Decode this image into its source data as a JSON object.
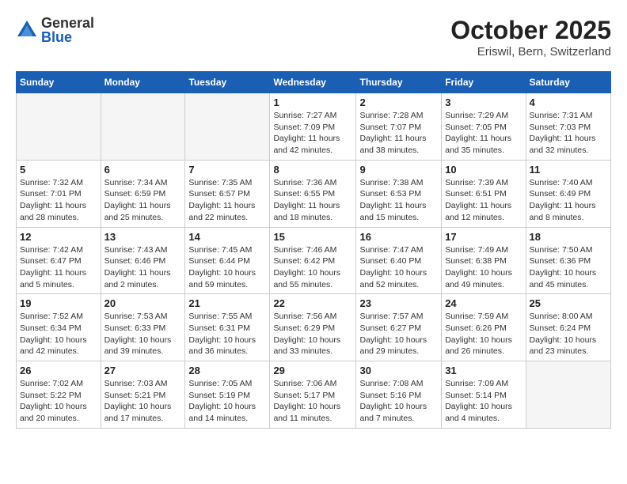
{
  "header": {
    "logo_general": "General",
    "logo_blue": "Blue",
    "month_title": "October 2025",
    "location": "Eriswil, Bern, Switzerland"
  },
  "weekdays": [
    "Sunday",
    "Monday",
    "Tuesday",
    "Wednesday",
    "Thursday",
    "Friday",
    "Saturday"
  ],
  "weeks": [
    [
      {
        "day": "",
        "info": ""
      },
      {
        "day": "",
        "info": ""
      },
      {
        "day": "",
        "info": ""
      },
      {
        "day": "1",
        "info": "Sunrise: 7:27 AM\nSunset: 7:09 PM\nDaylight: 11 hours and 42 minutes."
      },
      {
        "day": "2",
        "info": "Sunrise: 7:28 AM\nSunset: 7:07 PM\nDaylight: 11 hours and 38 minutes."
      },
      {
        "day": "3",
        "info": "Sunrise: 7:29 AM\nSunset: 7:05 PM\nDaylight: 11 hours and 35 minutes."
      },
      {
        "day": "4",
        "info": "Sunrise: 7:31 AM\nSunset: 7:03 PM\nDaylight: 11 hours and 32 minutes."
      }
    ],
    [
      {
        "day": "5",
        "info": "Sunrise: 7:32 AM\nSunset: 7:01 PM\nDaylight: 11 hours and 28 minutes."
      },
      {
        "day": "6",
        "info": "Sunrise: 7:34 AM\nSunset: 6:59 PM\nDaylight: 11 hours and 25 minutes."
      },
      {
        "day": "7",
        "info": "Sunrise: 7:35 AM\nSunset: 6:57 PM\nDaylight: 11 hours and 22 minutes."
      },
      {
        "day": "8",
        "info": "Sunrise: 7:36 AM\nSunset: 6:55 PM\nDaylight: 11 hours and 18 minutes."
      },
      {
        "day": "9",
        "info": "Sunrise: 7:38 AM\nSunset: 6:53 PM\nDaylight: 11 hours and 15 minutes."
      },
      {
        "day": "10",
        "info": "Sunrise: 7:39 AM\nSunset: 6:51 PM\nDaylight: 11 hours and 12 minutes."
      },
      {
        "day": "11",
        "info": "Sunrise: 7:40 AM\nSunset: 6:49 PM\nDaylight: 11 hours and 8 minutes."
      }
    ],
    [
      {
        "day": "12",
        "info": "Sunrise: 7:42 AM\nSunset: 6:47 PM\nDaylight: 11 hours and 5 minutes."
      },
      {
        "day": "13",
        "info": "Sunrise: 7:43 AM\nSunset: 6:46 PM\nDaylight: 11 hours and 2 minutes."
      },
      {
        "day": "14",
        "info": "Sunrise: 7:45 AM\nSunset: 6:44 PM\nDaylight: 10 hours and 59 minutes."
      },
      {
        "day": "15",
        "info": "Sunrise: 7:46 AM\nSunset: 6:42 PM\nDaylight: 10 hours and 55 minutes."
      },
      {
        "day": "16",
        "info": "Sunrise: 7:47 AM\nSunset: 6:40 PM\nDaylight: 10 hours and 52 minutes."
      },
      {
        "day": "17",
        "info": "Sunrise: 7:49 AM\nSunset: 6:38 PM\nDaylight: 10 hours and 49 minutes."
      },
      {
        "day": "18",
        "info": "Sunrise: 7:50 AM\nSunset: 6:36 PM\nDaylight: 10 hours and 45 minutes."
      }
    ],
    [
      {
        "day": "19",
        "info": "Sunrise: 7:52 AM\nSunset: 6:34 PM\nDaylight: 10 hours and 42 minutes."
      },
      {
        "day": "20",
        "info": "Sunrise: 7:53 AM\nSunset: 6:33 PM\nDaylight: 10 hours and 39 minutes."
      },
      {
        "day": "21",
        "info": "Sunrise: 7:55 AM\nSunset: 6:31 PM\nDaylight: 10 hours and 36 minutes."
      },
      {
        "day": "22",
        "info": "Sunrise: 7:56 AM\nSunset: 6:29 PM\nDaylight: 10 hours and 33 minutes."
      },
      {
        "day": "23",
        "info": "Sunrise: 7:57 AM\nSunset: 6:27 PM\nDaylight: 10 hours and 29 minutes."
      },
      {
        "day": "24",
        "info": "Sunrise: 7:59 AM\nSunset: 6:26 PM\nDaylight: 10 hours and 26 minutes."
      },
      {
        "day": "25",
        "info": "Sunrise: 8:00 AM\nSunset: 6:24 PM\nDaylight: 10 hours and 23 minutes."
      }
    ],
    [
      {
        "day": "26",
        "info": "Sunrise: 7:02 AM\nSunset: 5:22 PM\nDaylight: 10 hours and 20 minutes."
      },
      {
        "day": "27",
        "info": "Sunrise: 7:03 AM\nSunset: 5:21 PM\nDaylight: 10 hours and 17 minutes."
      },
      {
        "day": "28",
        "info": "Sunrise: 7:05 AM\nSunset: 5:19 PM\nDaylight: 10 hours and 14 minutes."
      },
      {
        "day": "29",
        "info": "Sunrise: 7:06 AM\nSunset: 5:17 PM\nDaylight: 10 hours and 11 minutes."
      },
      {
        "day": "30",
        "info": "Sunrise: 7:08 AM\nSunset: 5:16 PM\nDaylight: 10 hours and 7 minutes."
      },
      {
        "day": "31",
        "info": "Sunrise: 7:09 AM\nSunset: 5:14 PM\nDaylight: 10 hours and 4 minutes."
      },
      {
        "day": "",
        "info": ""
      }
    ]
  ]
}
